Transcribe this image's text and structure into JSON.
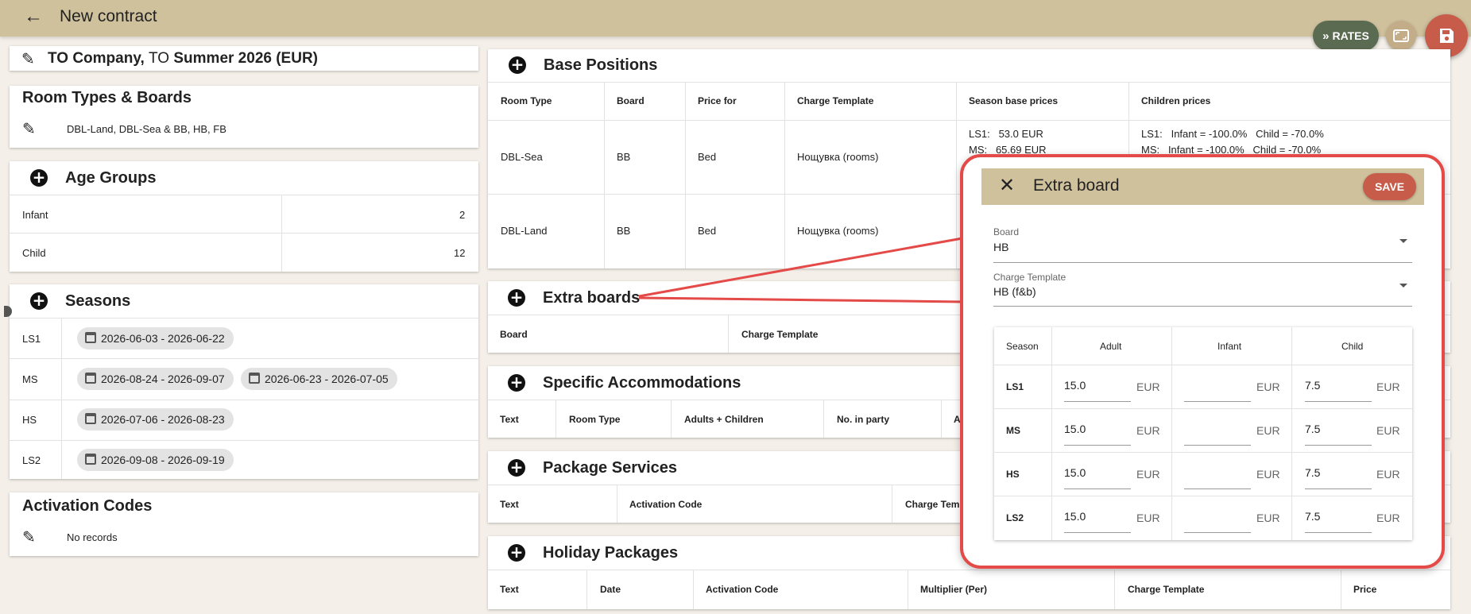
{
  "header": {
    "title": "New contract",
    "back_icon": "arrow-left-icon"
  },
  "fabs": {
    "rates_label": "RATES",
    "expand_icon": "fullscreen-icon",
    "save_icon": "floppy-disk-icon"
  },
  "contract": {
    "company": "TO Company,",
    "to": "TO",
    "season": "Summer 2026 (EUR)"
  },
  "room_types": {
    "title": "Room Types & Boards",
    "value": "DBL-Land, DBL-Sea & BB, HB, FB"
  },
  "age_groups": {
    "title": "Age Groups",
    "rows": [
      {
        "name": "Infant",
        "age": "2"
      },
      {
        "name": "Child",
        "age": "12"
      }
    ]
  },
  "seasons": {
    "title": "Seasons",
    "rows": [
      {
        "code": "LS1",
        "ranges": [
          "2026-06-03 - 2026-06-22"
        ]
      },
      {
        "code": "MS",
        "ranges": [
          "2026-08-24 - 2026-09-07",
          "2026-06-23 - 2026-07-05"
        ]
      },
      {
        "code": "HS",
        "ranges": [
          "2026-07-06 - 2026-08-23"
        ]
      },
      {
        "code": "LS2",
        "ranges": [
          "2026-09-08 - 2026-09-19"
        ]
      }
    ]
  },
  "activation_codes": {
    "title": "Activation Codes",
    "empty": "No records"
  },
  "base_positions": {
    "title": "Base Positions",
    "columns": [
      "Room Type",
      "Board",
      "Price for",
      "Charge Template",
      "Season base prices",
      "Children prices"
    ],
    "rows": [
      {
        "room": "DBL-Sea",
        "board": "BB",
        "price_for": "Bed",
        "template": "Нощувка (rooms)",
        "season_prices": [
          "LS1:   53.0 EUR",
          "MS:   65.69 EUR"
        ],
        "children_prices": [
          "LS1:   Infant = -100.0%   Child = -70.0%",
          "MS:   Infant = -100.0%   Child = -70.0%"
        ]
      },
      {
        "room": "DBL-Land",
        "board": "BB",
        "price_for": "Bed",
        "template": "Нощувка (rooms)",
        "season_prices": [],
        "children_prices": []
      }
    ]
  },
  "extra_boards": {
    "title": "Extra boards",
    "columns": [
      "Board",
      "Charge Template"
    ]
  },
  "specific_accommodations": {
    "title": "Specific Accommodations",
    "columns": [
      "Text",
      "Room Type",
      "Adults + Children",
      "No. in party",
      "A"
    ]
  },
  "package_services": {
    "title": "Package Services",
    "columns": [
      "Text",
      "Activation Code",
      "Charge Templ"
    ]
  },
  "holiday_packages": {
    "title": "Holiday Packages",
    "columns": [
      "Text",
      "Date",
      "Activation Code",
      "Multiplier (Per)",
      "Charge Template",
      "Price"
    ]
  },
  "dialog": {
    "title": "Extra board",
    "save_label": "SAVE",
    "close_icon": "close-icon",
    "board_label": "Board",
    "board_value": "HB",
    "template_label": "Charge Template",
    "template_value": "HB (f&b)",
    "columns": [
      "Season",
      "Adult",
      "Infant",
      "Child"
    ],
    "currency": "EUR",
    "rows": [
      {
        "season": "LS1",
        "adult": "15.0",
        "infant": "",
        "child": "7.5"
      },
      {
        "season": "MS",
        "adult": "15.0",
        "infant": "",
        "child": "7.5"
      },
      {
        "season": "HS",
        "adult": "15.0",
        "infant": "",
        "child": "7.5"
      },
      {
        "season": "LS2",
        "adult": "15.0",
        "infant": "",
        "child": "7.5"
      }
    ]
  },
  "colors": {
    "topbar": "#d0c19d",
    "highlight": "#e34a48",
    "save": "#c85c4a",
    "rates": "#5b6b51"
  }
}
